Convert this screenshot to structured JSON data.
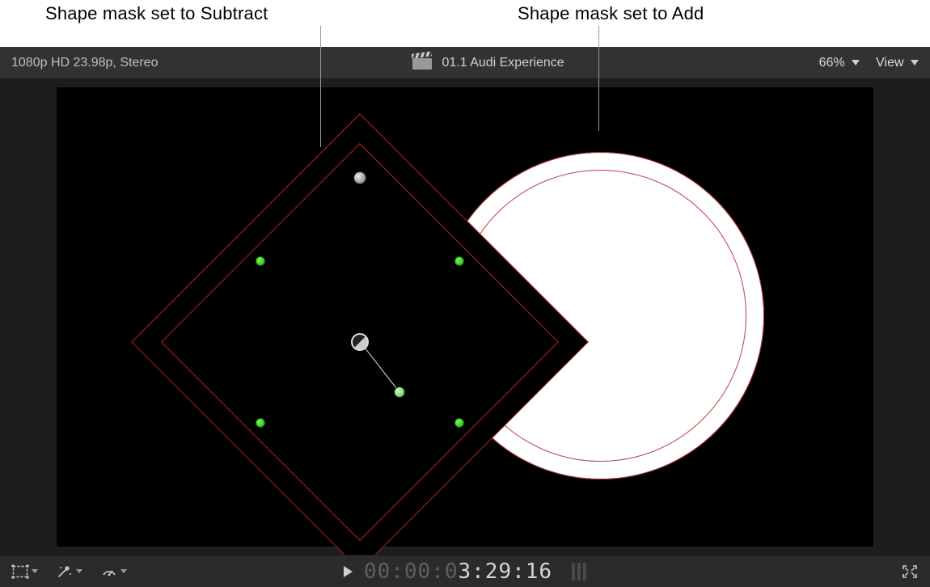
{
  "annotations": {
    "subtract_label": "Shape mask set to Subtract",
    "add_label": "Shape mask set to Add"
  },
  "toolbar": {
    "format": "1080p HD 23.98p, Stereo",
    "clip_name": "01.1 Audi Experience",
    "zoom": "66%",
    "view_label": "View"
  },
  "masks": {
    "add": {
      "type": "circle",
      "mode": "Add",
      "color": "#b02323"
    },
    "subtract": {
      "type": "rect-rotated",
      "mode": "Subtract",
      "color": "#b02323"
    }
  },
  "playback": {
    "timecode_dim": "00:00:0",
    "timecode_lit": "3:29:16"
  },
  "icons": {
    "transform_tool": "transform-tool",
    "effects_tool": "effects-wand",
    "retime_tool": "retime-dial",
    "clapper": "clapperboard",
    "fullscreen": "fullscreen"
  }
}
